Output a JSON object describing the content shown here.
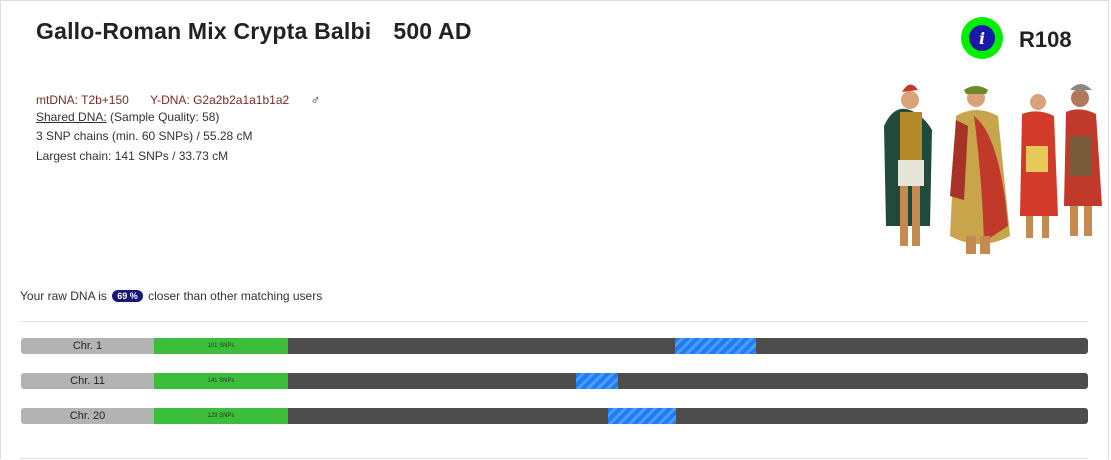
{
  "header": {
    "title": "Gallo-Roman Mix Crypta Balbi",
    "era": "500 AD",
    "info_icon": "info-icon",
    "code": "R108",
    "accent_color": "#00ee00"
  },
  "details": {
    "mtdna": "mtDNA: T2b+150",
    "ydna": "Y-DNA: G2a2b2a1a1b1a2",
    "sex_symbol": "♂",
    "shared_dna_label": "Shared DNA:",
    "sample_quality": "(Sample Quality: 58)",
    "chains": "3 SNP chains (min. 60 SNPs) / 55.28 cM",
    "largest": "Largest chain: 141 SNPs / 33.73 cM"
  },
  "comparison": {
    "prefix": "Your raw DNA is",
    "percent": "69 %",
    "suffix": "closer than other matching users"
  },
  "chromosomes": [
    {
      "label": "Chr. 1",
      "snps": "101 SNPs",
      "match_start": 0.558,
      "match_end": 0.645
    },
    {
      "label": "Chr. 11",
      "snps": "141 SNPs",
      "match_start": 0.452,
      "match_end": 0.497
    },
    {
      "label": "Chr. 20",
      "snps": "129 SNPs",
      "match_start": 0.486,
      "match_end": 0.559
    }
  ]
}
